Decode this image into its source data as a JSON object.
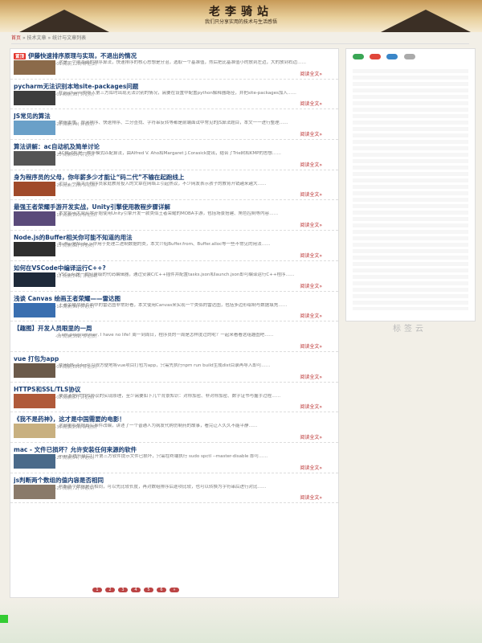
{
  "site": {
    "title": "老李骑站",
    "subtitle": "我们只分享实用的技术与生活感悟"
  },
  "breadcrumb": {
    "home": "首页",
    "sep": "»",
    "category": "技术文章",
    "current": "统计与文章列表"
  },
  "posts": [
    {
      "title": "伊藤快速排序原理与实现，不退出的情况",
      "tag": "置顶",
      "meta": "作者: admin  2018-07-01  阅读(123)  评论(2)",
      "excerpt": "这是一个很基础的排序算法，快速排序的核心思想是分治，选取一个基准值，然后把比基准值小的放到左边，大的放到右边……",
      "more": "阅读全文»",
      "thumb": "#8b6a4a"
    },
    {
      "title": "pycharm无法识别本地site-packages问题",
      "tag": "",
      "meta": "作者: admin  2018-07-01  阅读(98)  评论(0)",
      "excerpt": "在pycharm中导入第三方库时出现无法识别的情况，需要在设置中配置python解释器路径，并把site-packages加入……",
      "more": "阅读全文»",
      "thumb": "#3d3d3d"
    },
    {
      "title": "JS常见的算法",
      "tag": "",
      "meta": "作者: admin  2018-06-28  阅读(76)  评论(1)",
      "excerpt": "数组去重、冒泡排序、快速排序、二分查找、字符串反转等都是前端面试中常见的JS算法题目，本文一一进行整理……",
      "more": "阅读全文»",
      "thumb": "#6aa0c8"
    },
    {
      "title": "算法讲解：ac自动机及简单讨论",
      "tag": "",
      "meta": "作者: admin  2018-06-25  阅读(65)  评论(0)",
      "excerpt": "AC自动机是一种多模式匹配算法，由Alfred V. Aho和Margaret J.Corasick提出，结合了Trie树和KMP的思想……",
      "more": "阅读全文»",
      "thumb": "#555"
    },
    {
      "title": "身为程序员的父母，你年薪多少才能让“码二代”不输在起跑线上",
      "tag": "",
      "meta": "作者: admin  2018-06-20  阅读(210)  评论(5)",
      "excerpt": "近日，一篇关于程序员家庭教育投入的文章在网络上引起热议，不少网友表示孩子的教育开销越来越大……",
      "more": "阅读全文»",
      "thumb": "#a04a2a"
    },
    {
      "title": "最强王者荣耀手游开发实战，Unity引擎使用教程步骤详解",
      "tag": "",
      "meta": "作者: admin  2018-06-18  阅读(180)  评论(3)",
      "excerpt": "本文将带大家从零开始使用Unity引擎开发一款类似王者荣耀的MOBA手游，包括场景搭建、角色控制等内容……",
      "more": "阅读全文»",
      "thumb": "#5a4a7a"
    },
    {
      "title": "Node.js的Buffer相关你可能不知道的用法",
      "tag": "",
      "meta": "作者: admin  2018-06-15  阅读(88)  评论(0)",
      "excerpt": "Buffer是Node.js中用于处理二进制数据的类，本文介绍Buffer.from、Buffer.alloc等一些不常见的用法……",
      "more": "阅读全文»",
      "thumb": "#2e2e2e"
    },
    {
      "title": "如何在VSCode中编译运行C++?",
      "tag": "",
      "meta": "作者: admin  2018-06-12  阅读(143)  评论(4)",
      "excerpt": "VSCode是一款轻量级的代码编辑器，通过安装C/C++插件并配置tasks.json和launch.json即可编译运行C++程序……",
      "more": "阅读全文»",
      "thumb": "#1e2a3a"
    },
    {
      "title": "浅谈 Canvas 绘画王者荣耀——雷达图",
      "tag": "",
      "meta": "作者: admin  2018-06-10  阅读(99)  评论(1)",
      "excerpt": "王者荣耀战绩页面中的雷达图非常好看，本文使用Canvas来实现一个类似的雷达图，包括多边形绘制与数据填充……",
      "more": "阅读全文»",
      "thumb": "#3a6fb0"
    },
    {
      "title": "【趣图】开发人员眼里的一周",
      "tag": "",
      "meta": "作者: admin  2018-06-08  阅读(302)  评论(8)",
      "excerpt": "I am programmer, I have no life! 周一到周日，程序员的一周是怎样度过的呢？一起来看看这组趣图吧……",
      "more": "阅读全文»",
      "thumb": "#ffffff"
    },
    {
      "title": "vue 打包为app",
      "tag": "",
      "meta": "作者: admin  2018-06-05  阅读(120)  评论(2)",
      "excerpt": "使用HBuilder可以很方便地将vue项目打包为app，只需先执行npm run build生成dist目录再导入即可……",
      "more": "阅读全文»",
      "thumb": "#6b5a4a"
    },
    {
      "title": "HTTPS和SSL/TLS协议",
      "tag": "",
      "meta": "作者: admin  2018-06-02  阅读(87)  评论(0)",
      "excerpt": "要说清楚HTTPS协议的实现原理，至少需要如下几个背景知识：对称加密、非对称加密、数字证书与握手过程……",
      "more": "阅读全文»",
      "thumb": "#b05a3a"
    },
    {
      "title": "《我不是药神》，这才是中国需要的电影！",
      "tag": "",
      "meta": "作者: admin  2018-05-30  阅读(256)  评论(6)",
      "excerpt": "这部电影根据真实事件改编，讲述了一个普通人为病友代购仿制药的故事，看完让人久久不能平静……",
      "more": "阅读全文»",
      "thumb": "#c8b080"
    },
    {
      "title": "mac - 文件已损坏？允许安装任何来源的软件",
      "tag": "",
      "meta": "作者: admin  2018-05-28  阅读(64)  评论(0)",
      "excerpt": "mac系统升级后打开第三方软件提示文件已损坏，只需在终端执行 sudo spctl --master-disable 即可……",
      "more": "阅读全文»",
      "thumb": "#4a6a8a"
    },
    {
      "title": "js判断两个数组的值内容是否相同",
      "tag": "",
      "meta": "作者: admin  2018-05-25  阅读(72)  评论(1)",
      "excerpt": "判断两个数组是否相同，可以先比较长度，再对数组排序后逐项比较，也可以转换为字符串后进行对比……",
      "more": "阅读全文»",
      "thumb": "#8a7a6a"
    }
  ],
  "pagination": [
    "1",
    "2",
    "3",
    "4",
    "5",
    "6",
    "»"
  ],
  "sidebar": {
    "label": "标签云"
  },
  "colors": {
    "accent": "#b33333",
    "link": "#1b3f73"
  }
}
